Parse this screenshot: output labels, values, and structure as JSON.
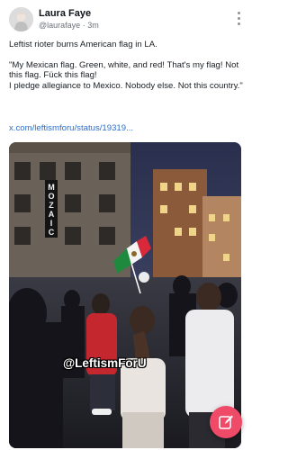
{
  "post": {
    "author_name": "Laura Faye",
    "handle": "@laurafaye",
    "separator": "·",
    "time": "3m",
    "text_lines": [
      "Leftist rioter burns American flag in LA.",
      "\"My Mexican flag. Green, white, and red! That's my flag! Not this flag. Fück this flag!",
      "I pledge allegiance to Mexico. Nobody else. Not this country.\""
    ],
    "link": "x.com/leftismforu/status/19319...",
    "media": {
      "watermark": "@LeftismForU",
      "sign_letters": [
        "M",
        "O",
        "Z",
        "A",
        "I",
        "C"
      ]
    }
  },
  "actions": {
    "more_icon": "more-vertical-icon",
    "compose_icon": "edit-icon"
  },
  "colors": {
    "link": "#2b6ec8",
    "fab": "#ef4a67",
    "muted": "#6b7178"
  }
}
